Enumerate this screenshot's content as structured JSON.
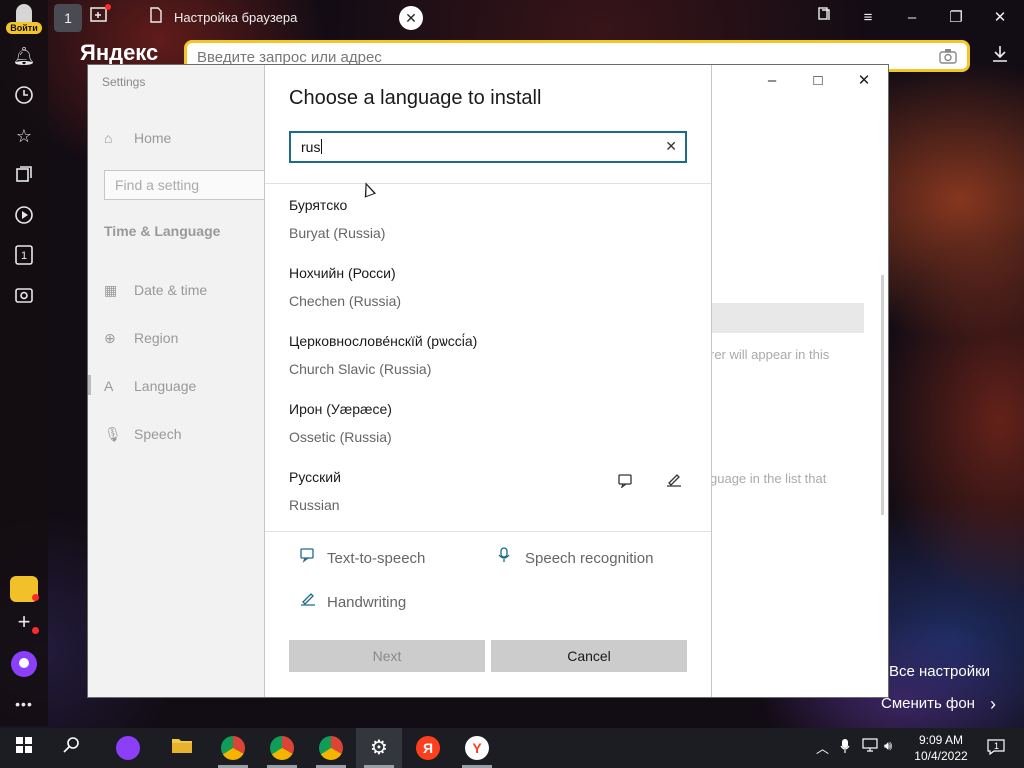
{
  "browser": {
    "login_label": "Войти",
    "tab_title": "Настройка браузера",
    "tab_count": "1",
    "logo": "Яндекс",
    "address_placeholder": "Введите запрос или адрес",
    "sidebar_counter": "1",
    "all_settings": "Все настройки",
    "change_background": "Сменить фон"
  },
  "settings": {
    "window_title": "Settings",
    "nav_home": "Home",
    "find_placeholder": "Find a setting",
    "section": "Time & Language",
    "nav": [
      "Date & time",
      "Region",
      "Language",
      "Speech"
    ],
    "ghost_1": "rer will appear in this",
    "ghost_2": "guage in the list that"
  },
  "dialog": {
    "title": "Choose a language to install",
    "search_value": "rus",
    "languages": [
      {
        "native": "Бурятско",
        "english": "Buryat (Russia)"
      },
      {
        "native": "Нохчийн (Росси)",
        "english": "Chechen (Russia)"
      },
      {
        "native": "Церковнослове́нскїй (рѡссі́а)",
        "english": "Church Slavic (Russia)"
      },
      {
        "native": "Ирон (Уæрæсе)",
        "english": "Ossetic (Russia)"
      },
      {
        "native": "Русский",
        "english": "Russian"
      }
    ],
    "legend": {
      "tts": "Text-to-speech",
      "speech": "Speech recognition",
      "handwriting": "Handwriting"
    },
    "next_label": "Next",
    "cancel_label": "Cancel"
  },
  "taskbar": {
    "time": "9:09 AM",
    "date": "10/4/2022",
    "notif_count": "1"
  },
  "icons": {
    "accent": "#1e6a8a",
    "yandex_yellow": "#f5c425"
  }
}
